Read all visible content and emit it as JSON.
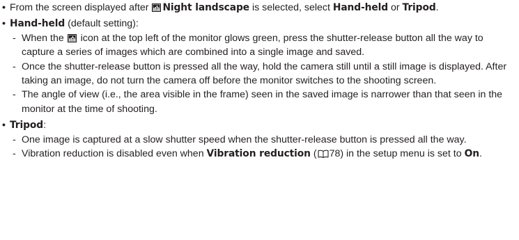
{
  "bullets": {
    "item1": {
      "pre": "From the screen displayed after ",
      "icon": "night-landscape-icon",
      "bold1": "Night landscape",
      "mid1": " is selected, select ",
      "bold2": "Hand-held",
      "mid2": " or ",
      "bold3": "Tripod",
      "post": "."
    },
    "item2": {
      "bold": "Hand-held",
      "post": " (default setting):",
      "sub1": {
        "pre": "When the ",
        "icon": "night-landscape-icon",
        "post": " icon at the top left of the monitor glows green, press the shutter-release button all the way to capture a series of images which are combined into a single image and saved."
      },
      "sub2": "Once the shutter-release button is pressed all the way, hold the camera still until a still image is displayed. After taking an image, do not turn the camera off before the monitor switches to the shooting screen.",
      "sub3": "The angle of view (i.e., the area visible in the frame) seen in the saved image is narrower than that seen in the monitor at the time of shooting."
    },
    "item3": {
      "bold": "Tripod",
      "post": ":",
      "sub1": "One image is captured at a slow shutter speed when the shutter-release button is pressed all the way.",
      "sub2": {
        "pre": "Vibration reduction is disabled even when ",
        "bold1": "Vibration reduction",
        "mid1": " (",
        "icon": "book-reference-icon",
        "page_ref": "78",
        "mid2": ") in the setup menu is set to ",
        "bold2": "On",
        "post": "."
      }
    }
  },
  "symbols": {
    "bullet": "•",
    "dash": "-"
  }
}
